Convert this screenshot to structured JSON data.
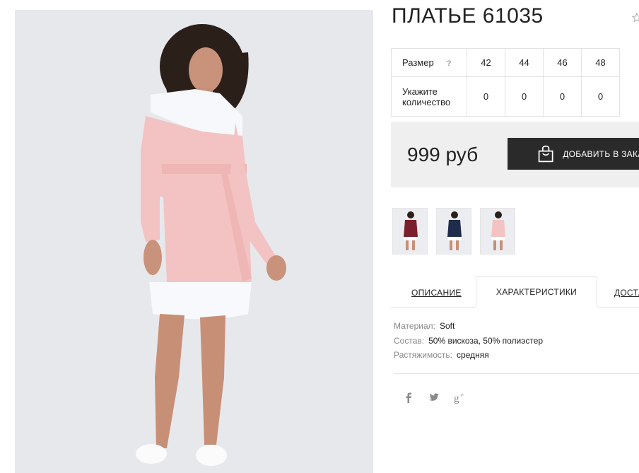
{
  "product": {
    "title": "ПЛАТЬЕ 61035"
  },
  "size_table": {
    "size_label": "Размер",
    "help_glyph": "?",
    "sizes": [
      "42",
      "44",
      "46",
      "48"
    ],
    "qty_label_line1": "Укажите",
    "qty_label_line2": "количество",
    "quantities": [
      "0",
      "0",
      "0",
      "0"
    ]
  },
  "price": "999 руб",
  "cart_button_label": "ДОБАВИТЬ В ЗАКАЗ",
  "colors": {
    "dark_button": "#2a2a2a",
    "price_bg": "#efefef",
    "dress_pink": "#f2c3c2",
    "thumb_burgundy": "#7a1f2b",
    "thumb_navy": "#1f2c4a"
  },
  "tabs": {
    "description": "ОПИСАНИЕ",
    "characteristics": "ХАРАКТЕРИСТИКИ",
    "delivery": "ДОСТАВКА"
  },
  "specs": [
    {
      "key": "Материал:",
      "value": "Soft"
    },
    {
      "key": "Состав:",
      "value": "50% вискоза, 50% полиэстер"
    },
    {
      "key": "Растяжимость:",
      "value": "средняя"
    }
  ],
  "social_icons": [
    "facebook-icon",
    "twitter-icon",
    "google-plus-icon"
  ]
}
